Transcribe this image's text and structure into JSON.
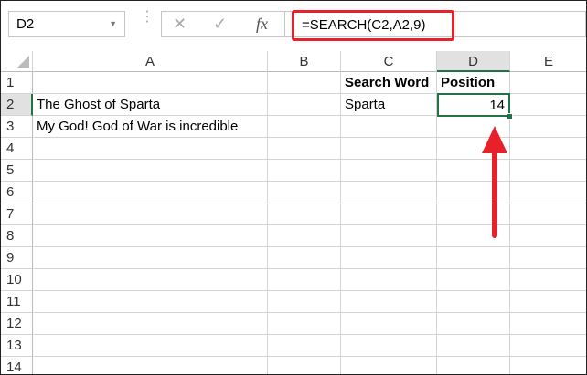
{
  "name_box": "D2",
  "formula": "=SEARCH(C2,A2,9)",
  "formula_icons": [
    "cancel-icon",
    "enter-icon",
    "fx-icon"
  ],
  "fx_label": "fx",
  "columns": [
    "A",
    "B",
    "C",
    "D",
    "E"
  ],
  "rows": [
    "1",
    "2",
    "3",
    "4",
    "5",
    "6",
    "7",
    "8",
    "9",
    "10",
    "11",
    "12",
    "13",
    "14"
  ],
  "cells": {
    "C1": "Search Word",
    "D1": "Position",
    "A2": "The Ghost of Sparta",
    "C2": "Sparta",
    "D2": "14",
    "A3": "My God! God of War is incredible"
  },
  "colors": {
    "highlight": "#e8202a",
    "selection": "#217346"
  }
}
